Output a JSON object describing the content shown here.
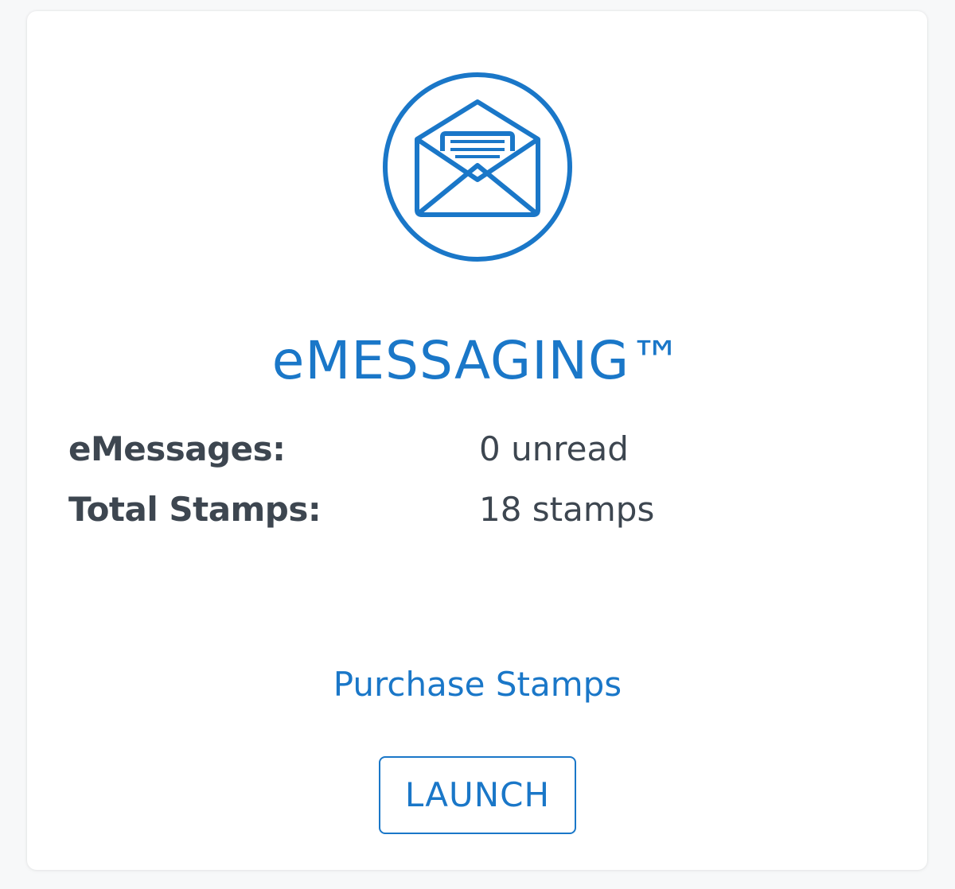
{
  "card": {
    "icon": "open-envelope-icon",
    "accent_color": "#1a77c8",
    "text_color": "#3d4650",
    "title": "eMESSAGING™",
    "rows": [
      {
        "label": "eMessages:",
        "value": "0 unread"
      },
      {
        "label": "Total Stamps:",
        "value": "18 stamps"
      }
    ],
    "purchase_link": "Purchase Stamps",
    "launch_label": "LAUNCH"
  }
}
